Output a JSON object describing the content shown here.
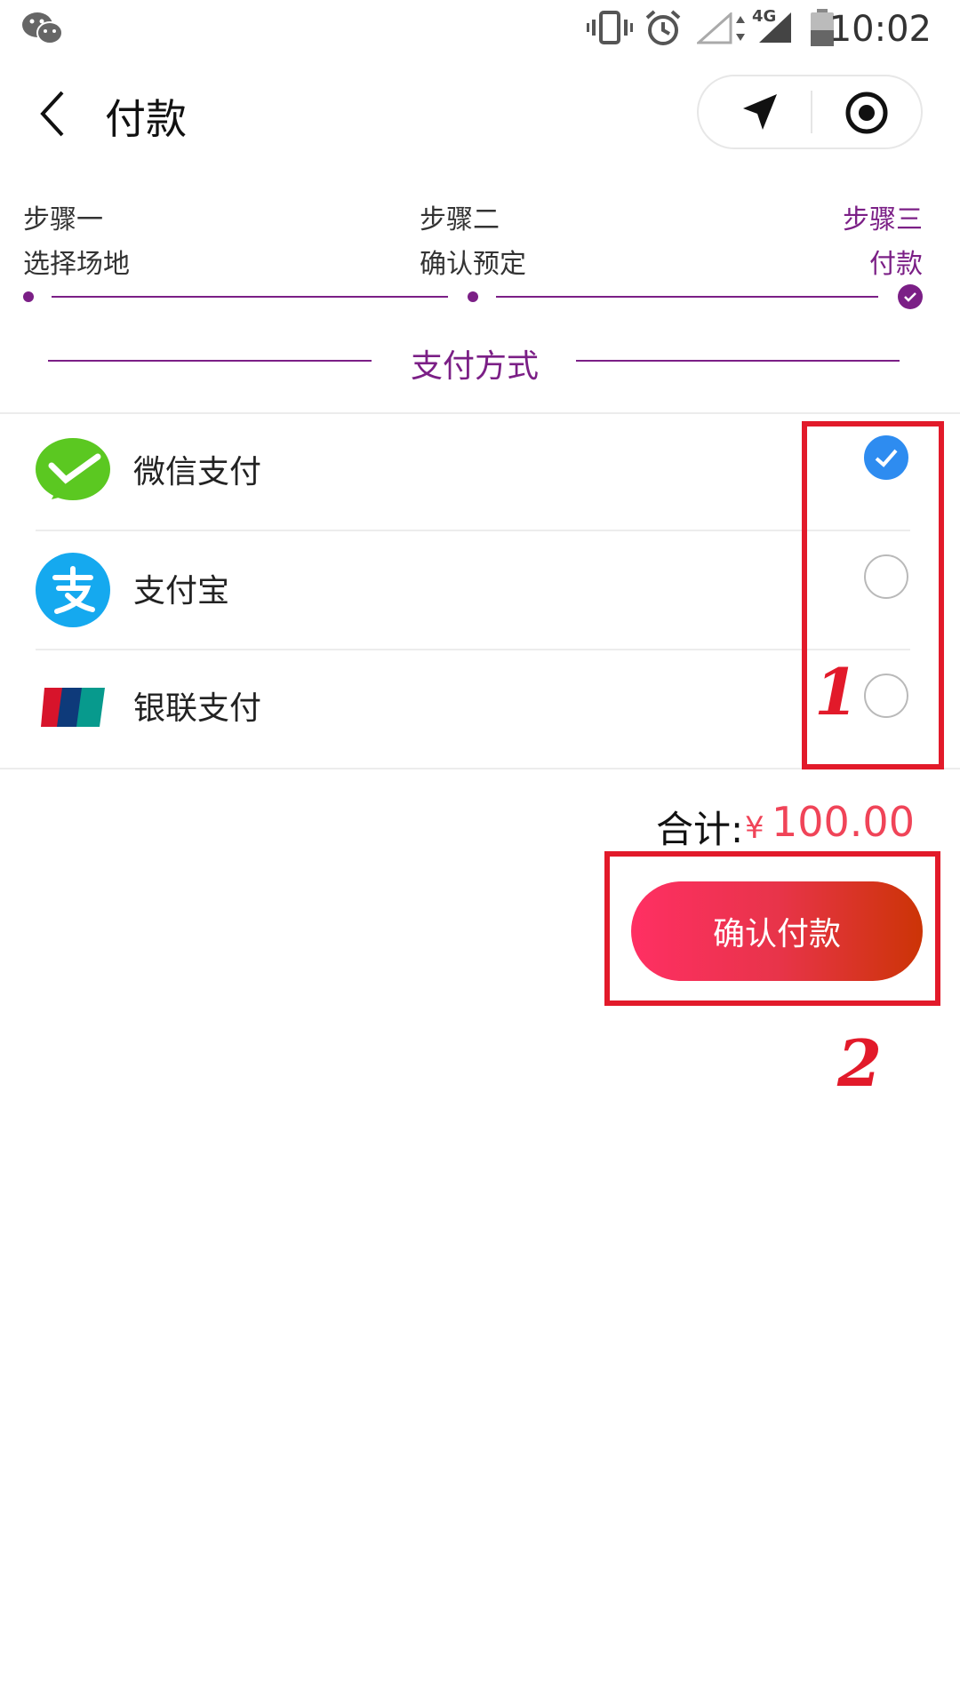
{
  "status_bar": {
    "time": "10:02",
    "network": "4G",
    "icons": [
      "wechat-icon",
      "vibrate-icon",
      "alarm-icon",
      "signal-icon",
      "battery-icon"
    ]
  },
  "nav": {
    "title": "付款",
    "icons": [
      "back-icon",
      "location-icon",
      "record-icon"
    ]
  },
  "steps": [
    {
      "step": "步骤一",
      "name": "选择场地",
      "active": false
    },
    {
      "step": "步骤二",
      "name": "确认预定",
      "active": false
    },
    {
      "step": "步骤三",
      "name": "付款",
      "active": true
    }
  ],
  "payment_section": {
    "title": "支付方式",
    "methods": [
      {
        "label": "微信支付",
        "icon": "wechat-pay-icon",
        "selected": true
      },
      {
        "label": "支付宝",
        "icon": "alipay-icon",
        "selected": false
      },
      {
        "label": "银联支付",
        "icon": "unionpay-icon",
        "selected": false
      }
    ]
  },
  "summary": {
    "total_label": "合计:",
    "currency_symbol": "¥",
    "total_amount": "100.00",
    "confirm_label": "确认付款"
  },
  "annotations": [
    "1",
    "2"
  ],
  "colors": {
    "accent": "#7b1f86",
    "price": "#f04458",
    "radio_checked": "#2e8cf0",
    "annotation": "#e21a2a"
  }
}
